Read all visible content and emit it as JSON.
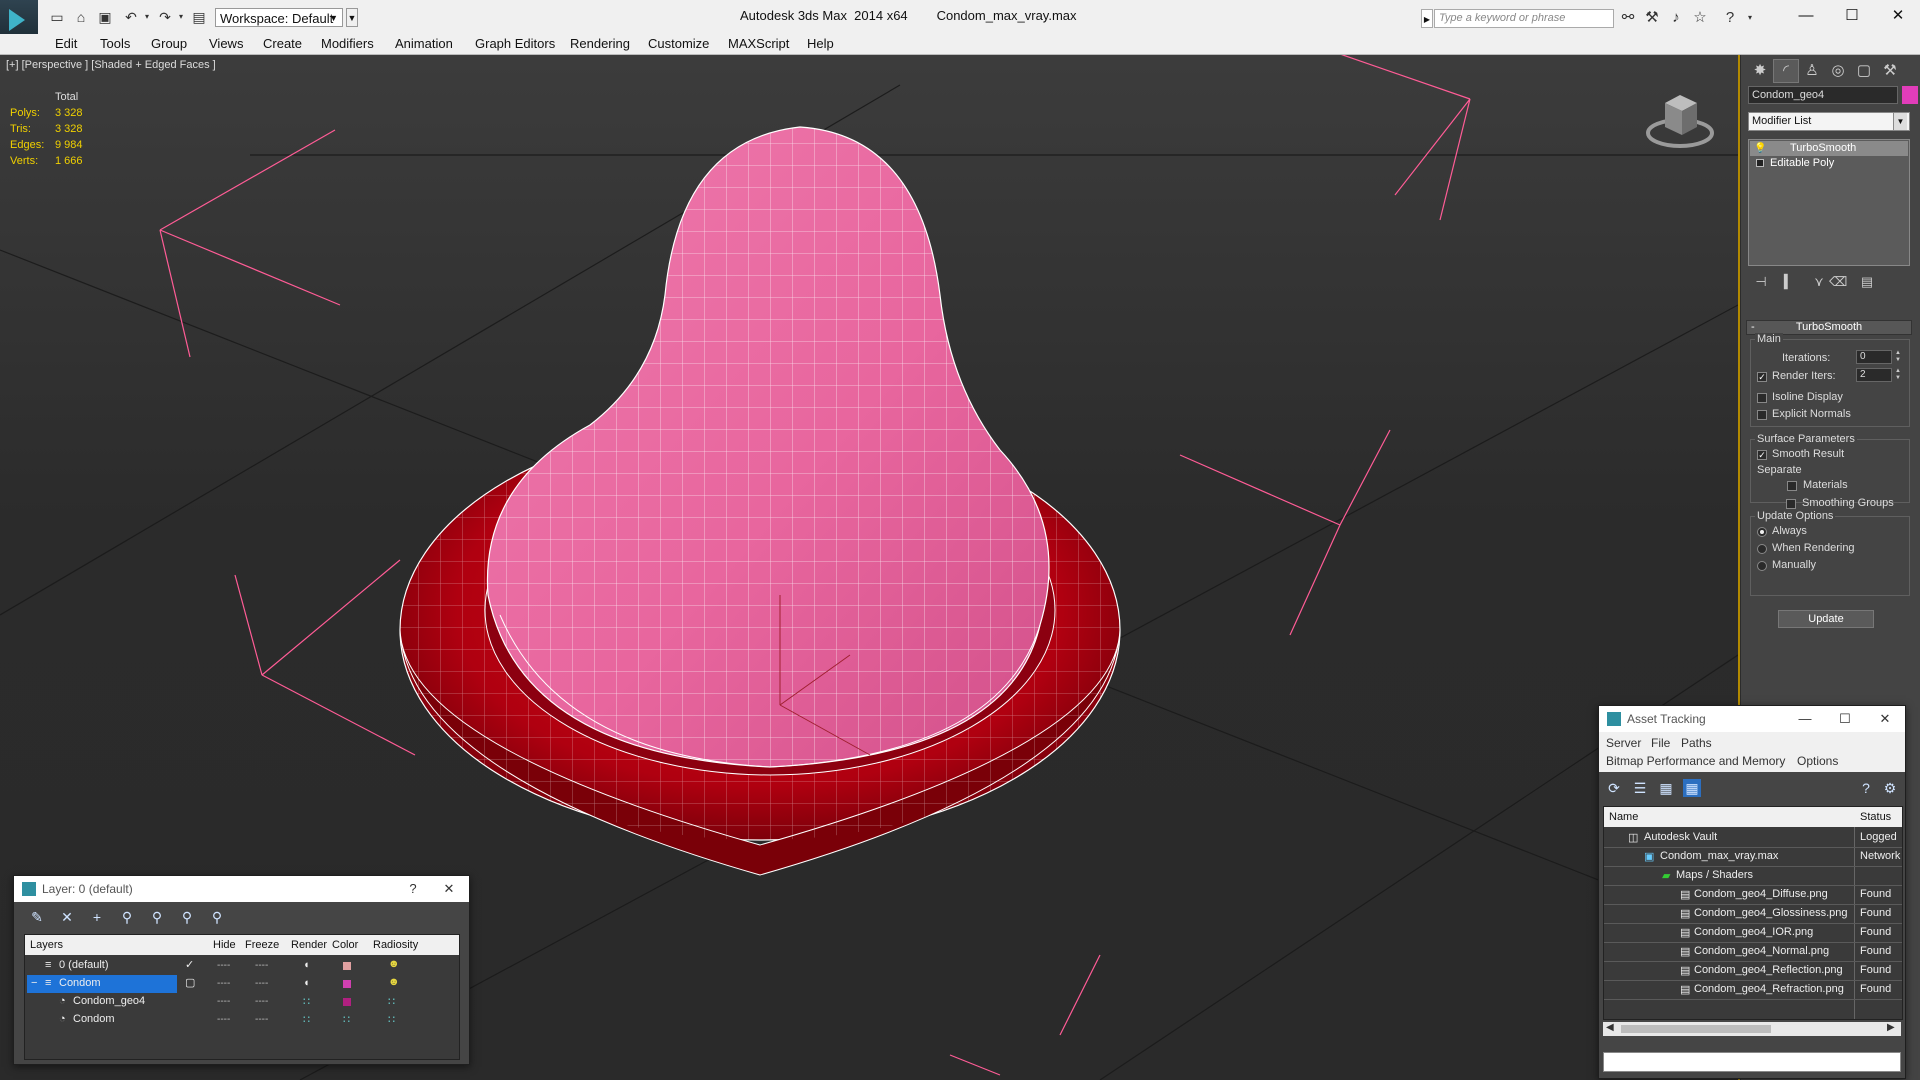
{
  "titlebar": {
    "app_title": "Autodesk 3ds Max  2014 x64",
    "file_name": "Condom_max_vray.max",
    "workspace": "Workspace: Default",
    "search_placeholder": "Type a keyword or phrase"
  },
  "menu": [
    "Edit",
    "Tools",
    "Group",
    "Views",
    "Create",
    "Modifiers",
    "Animation",
    "Graph Editors",
    "Rendering",
    "Customize",
    "MAXScript",
    "Help"
  ],
  "viewport": {
    "label": "[+] [Perspective ] [Shaded + Edged Faces ]",
    "stats": {
      "header": "Total",
      "rows": [
        {
          "label": "Polys:",
          "value": "3 328"
        },
        {
          "label": "Tris:",
          "value": "3 328"
        },
        {
          "label": "Edges:",
          "value": "9 984"
        },
        {
          "label": "Verts:",
          "value": "1 666"
        }
      ]
    }
  },
  "command_panel": {
    "object_name": "Condom_geo4",
    "object_color": "#e23dba",
    "modifier_list": "Modifier List",
    "stack": [
      "TurboSmooth",
      "Editable Poly"
    ],
    "rollout_title": "TurboSmooth",
    "main_label": "Main",
    "iterations_label": "Iterations:",
    "iterations_value": "0",
    "render_iters_label": "Render Iters:",
    "render_iters_value": "2",
    "isoline_label": "Isoline Display",
    "explicit_normals_label": "Explicit Normals",
    "surface_params_label": "Surface Parameters",
    "smooth_result_label": "Smooth Result",
    "separate_label": "Separate",
    "materials_label": "Materials",
    "smoothing_groups_label": "Smoothing Groups",
    "update_options_label": "Update Options",
    "always_label": "Always",
    "when_rendering_label": "When Rendering",
    "manually_label": "Manually",
    "update_button": "Update"
  },
  "layer_window": {
    "title": "Layer: 0 (default)",
    "help": "?",
    "close": "✕",
    "columns": [
      "Layers",
      "Hide",
      "Freeze",
      "Render",
      "Color",
      "Radiosity"
    ],
    "rows": [
      {
        "name": "0 (default)",
        "color": "#e0a0a0"
      },
      {
        "name": "Condom",
        "color": "#d040b0"
      },
      {
        "name": "Condom_geo4",
        "color": "#b02080"
      },
      {
        "name": "Condom",
        "color": ""
      }
    ]
  },
  "asset_window": {
    "title": "Asset Tracking",
    "menu1": [
      "Server",
      "File",
      "Paths"
    ],
    "menu2": [
      "Bitmap Performance and Memory",
      "Options"
    ],
    "col_name": "Name",
    "col_status": "Status",
    "rows": [
      {
        "name": "Autodesk Vault",
        "status": "Logged"
      },
      {
        "name": "Condom_max_vray.max",
        "status": "Network"
      },
      {
        "name": "Maps / Shaders",
        "status": ""
      },
      {
        "name": "Condom_geo4_Diffuse.png",
        "status": "Found"
      },
      {
        "name": "Condom_geo4_Glossiness.png",
        "status": "Found"
      },
      {
        "name": "Condom_geo4_IOR.png",
        "status": "Found"
      },
      {
        "name": "Condom_geo4_Normal.png",
        "status": "Found"
      },
      {
        "name": "Condom_geo4_Reflection.png",
        "status": "Found"
      },
      {
        "name": "Condom_geo4_Refraction.png",
        "status": "Found"
      }
    ]
  }
}
